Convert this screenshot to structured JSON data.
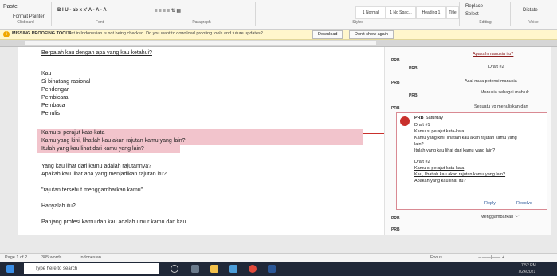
{
  "ribbon": {
    "paste": "Paste",
    "format_painter": "Format Painter",
    "clipboard": "Clipboard",
    "font": "Font",
    "paragraph": "Paragraph",
    "styles_label": "Styles",
    "editing": "Editing",
    "voice": "Voice",
    "styles": [
      "1 Normal",
      "1 No Spac...",
      "Heading 1",
      "Heading 2",
      "Title"
    ],
    "replace": "Replace",
    "select": "Select",
    "dictate": "Dictate",
    "font_tools": "B I U - ab x x' A - A - A"
  },
  "message_bar": {
    "title": "MISSING PROOFING TOOLS",
    "message": "Text in Indonesian is not being checked. Do you want to download proofing tools and future updates?",
    "download": "Download",
    "dont_show": "Don't show again"
  },
  "document": {
    "lines": [
      "Berpalah kau dengan apa yang kau ketahui?",
      "Kau",
      "Si binatang rasional",
      "Pendengar",
      "Pembicara",
      "Pembaca",
      "Penulis"
    ],
    "highlighted": [
      "Kamu si perajut kata-kata",
      "Kamu yang kini, lihatlah kau akan rajutan kamu yang lain?",
      "Itulah yang kau lihat dari kamu yang lain?"
    ],
    "after": [
      "Yang kau lihat dari kamu adalah rajutannya?",
      "Apakah kau lihat apa yang menjadikan rajutan itu?",
      "\"rajutan tersebut menggambarkan kamu\"",
      "Hanyalah itu?",
      "Panjang profesi kamu dan kau adalah umur kamu dan kau"
    ]
  },
  "comments": {
    "items": [
      {
        "pri": "PRB",
        "text": "Apakah manusia itu?"
      },
      {
        "pri": "PRB",
        "text": "Draft #2"
      },
      {
        "pri": "PRB",
        "text": "Asal mula potensi manusia"
      },
      {
        "pri": "PRB",
        "text": "Manusia sebagai mahluk"
      },
      {
        "pri": "PRB",
        "text": "Sesuatu yg menuliskan dan"
      }
    ],
    "card": {
      "author": "PRB",
      "time": "Saturday",
      "lines": [
        "Draft #1",
        "Kamu si perajut kata-kata",
        "Kamu yang kini, lihatlah kau akan rajutan kamu yang",
        "lain?",
        "Itulah yang kau lihat dari kamu yang lain?",
        "",
        "Draft #2",
        "Kamu si perajut kata-kata",
        "Kau, lihatlah kau akan rajutan kamu yang lain?",
        "Apakah yang kau lihat itu?"
      ],
      "reply": "Reply",
      "resolve": "Resolve"
    },
    "bottom": [
      {
        "pri": "PRB",
        "text": "Menggambarkan \"-\""
      },
      {
        "pri": "PRB",
        "text": ""
      }
    ]
  },
  "status": {
    "page": "Page 1 of 2",
    "words": "385 words",
    "lang": "Indonesian",
    "focus": "Focus"
  },
  "taskbar": {
    "search_placeholder": "Type here to search",
    "time": "7:52 PM",
    "date": "7/24/2021"
  }
}
